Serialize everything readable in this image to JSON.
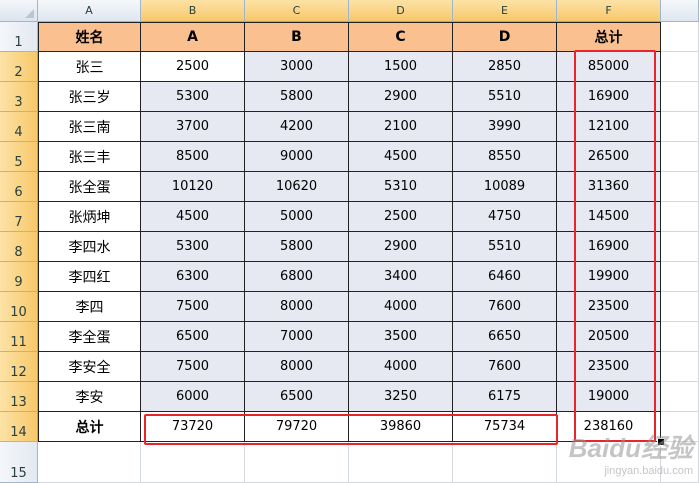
{
  "columns": [
    "A",
    "B",
    "C",
    "D",
    "E",
    "F"
  ],
  "rows": [
    "1",
    "2",
    "3",
    "4",
    "5",
    "6",
    "7",
    "8",
    "9",
    "10",
    "11",
    "12",
    "13",
    "14",
    "15"
  ],
  "header": [
    "姓名",
    "A",
    "B",
    "C",
    "D",
    "总计"
  ],
  "data": [
    [
      "张三",
      "2500",
      "3000",
      "1500",
      "2850",
      "85000"
    ],
    [
      "张三岁",
      "5300",
      "5800",
      "2900",
      "5510",
      "16900"
    ],
    [
      "张三南",
      "3700",
      "4200",
      "2100",
      "3990",
      "12100"
    ],
    [
      "张三丰",
      "8500",
      "9000",
      "4500",
      "8550",
      "26500"
    ],
    [
      "张全蛋",
      "10120",
      "10620",
      "5310",
      "10089",
      "31360"
    ],
    [
      "张炳坤",
      "4500",
      "5000",
      "2500",
      "4750",
      "14500"
    ],
    [
      "李四水",
      "5300",
      "5800",
      "2900",
      "5510",
      "16900"
    ],
    [
      "李四红",
      "6300",
      "6800",
      "3400",
      "6460",
      "19900"
    ],
    [
      "李四",
      "7500",
      "8000",
      "4000",
      "7600",
      "23500"
    ],
    [
      "李全蛋",
      "6500",
      "7000",
      "3500",
      "6650",
      "20500"
    ],
    [
      "李安全",
      "7500",
      "8000",
      "4000",
      "7600",
      "23500"
    ],
    [
      "李安",
      "6000",
      "6500",
      "3250",
      "6175",
      "19000"
    ]
  ],
  "totals": [
    "总计",
    "73720",
    "79720",
    "39860",
    "75734",
    "238160"
  ],
  "watermark": {
    "main": "Baidu经验",
    "sub": "jingyan.baidu.com"
  },
  "colors": {
    "header_fill": "#fac090",
    "data_fill": "#e6e8f2",
    "highlight": "#e8252b"
  }
}
